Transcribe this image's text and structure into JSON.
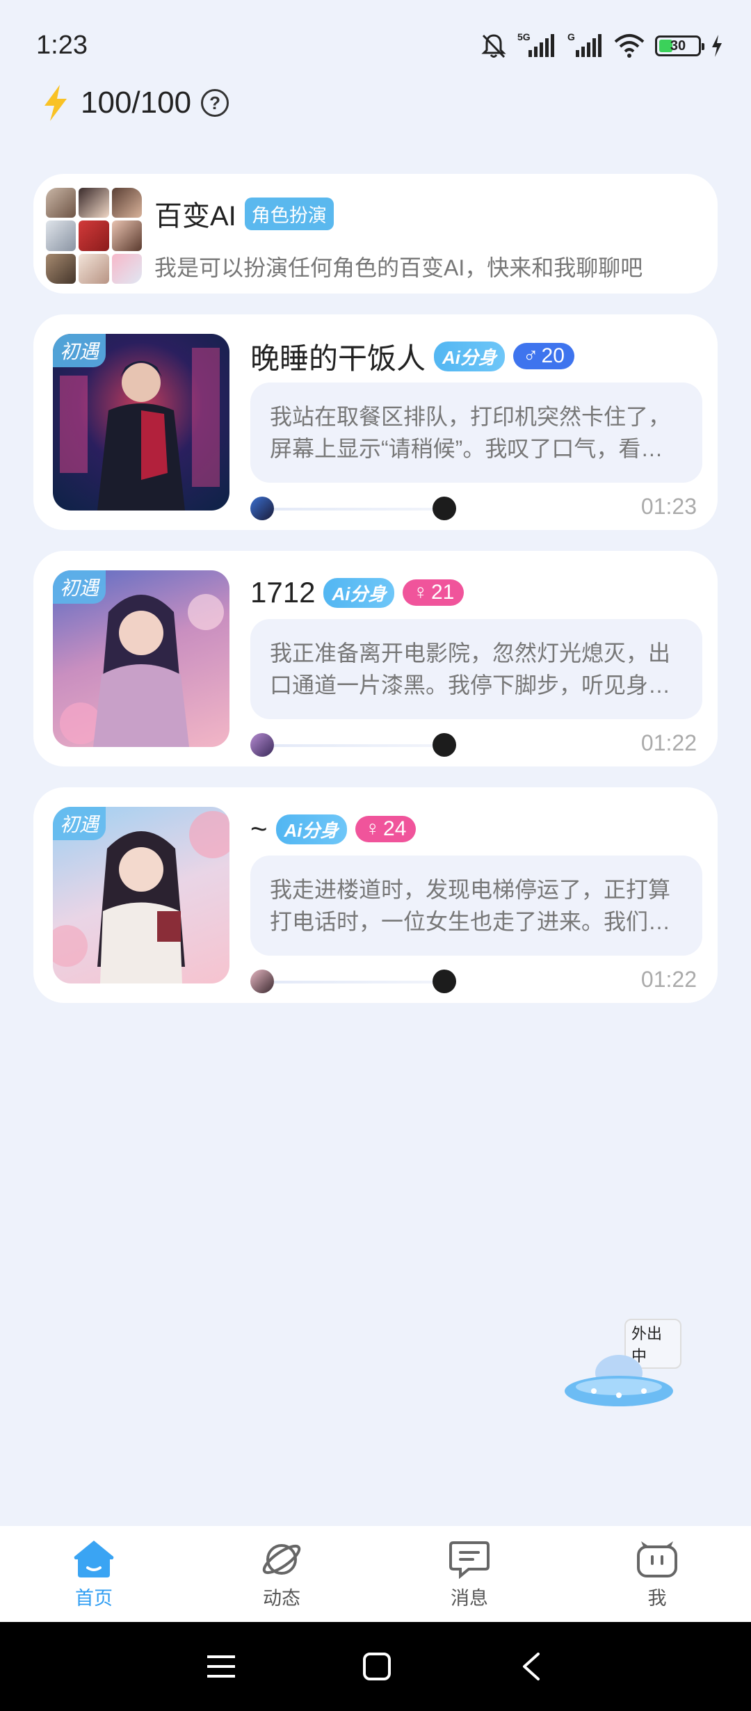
{
  "status_bar": {
    "time": "1:23",
    "network_5g": "5G",
    "network_g": "G",
    "battery_level": "30"
  },
  "energy": {
    "value": "100/100",
    "help_label": "?"
  },
  "ai_card": {
    "name": "百变AI",
    "tag": "角色扮演",
    "desc": "我是可以扮演任何角色的百变AI，快来和我聊聊吧"
  },
  "chats": [
    {
      "badge": "初遇",
      "name": "晚睡的干饭人",
      "ai_tag": "Ai分身",
      "gender": "male",
      "gender_symbol": "♂",
      "level": "20",
      "line1": "我站在取餐区排队，打印机突然卡住了，",
      "line2": "屏幕上显示“请稍候”。我叹了口气，看…",
      "time": "01:23"
    },
    {
      "badge": "初遇",
      "name": "1712",
      "ai_tag": "Ai分身",
      "gender": "female",
      "gender_symbol": "♀",
      "level": "21",
      "line1": "我正准备离开电影院，忽然灯光熄灭，出",
      "line2": "口通道一片漆黑。我停下脚步，听见身…",
      "time": "01:22"
    },
    {
      "badge": "初遇",
      "name": "~",
      "ai_tag": "Ai分身",
      "gender": "female",
      "gender_symbol": "♀",
      "level": "24",
      "line1": "我走进楼道时，发现电梯停运了，正打算",
      "line2": "打电话时，一位女生也走了进来。我们…",
      "time": "01:22"
    }
  ],
  "floating": {
    "label": "外出中"
  },
  "bottom_nav": {
    "home": "首页",
    "feed": "动态",
    "messages": "消息",
    "me": "我"
  },
  "colors": {
    "accent": "#2f9df2",
    "male": "#3e74ee",
    "female": "#f0549b"
  }
}
